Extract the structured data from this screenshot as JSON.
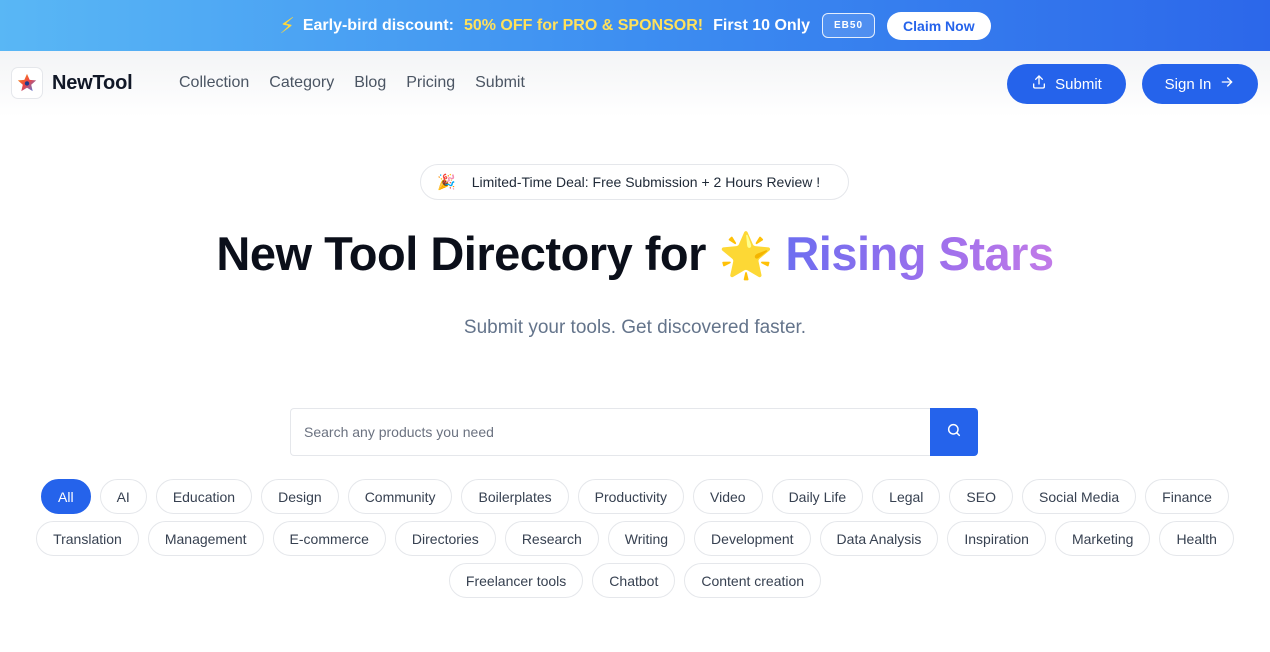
{
  "promo": {
    "prefix": "Early-bird discount:",
    "highlight": "50% OFF for PRO & SPONSOR!",
    "suffix": "First 10 Only",
    "code": "EB50",
    "claim_label": "Claim Now"
  },
  "nav": {
    "brand": "NewTool",
    "links": [
      "Collection",
      "Category",
      "Blog",
      "Pricing",
      "Submit"
    ],
    "submit_label": "Submit",
    "signin_label": "Sign In"
  },
  "hero": {
    "deal_text": "Limited-Time Deal: Free Submission + 2 Hours Review !",
    "title_main": "New Tool Directory for",
    "title_emoji": "🌟",
    "title_highlight": "Rising Stars",
    "subtitle": "Submit your tools. Get discovered faster."
  },
  "search": {
    "placeholder": "Search any products you need",
    "value": ""
  },
  "categories": {
    "selected": "All",
    "row1": [
      "All",
      "AI",
      "Education",
      "Design",
      "Community",
      "Boilerplates",
      "Productivity",
      "Video",
      "Daily Life",
      "Legal",
      "SEO",
      "Social Media",
      "Finance"
    ],
    "row2": [
      "Translation",
      "Management",
      "E-commerce",
      "Directories",
      "Research",
      "Writing",
      "Development",
      "Data Analysis",
      "Inspiration",
      "Marketing",
      "Health"
    ],
    "row3": [
      "Freelancer tools",
      "Chatbot",
      "Content creation"
    ]
  },
  "colors": {
    "accent": "#2563eb",
    "promo_highlight": "#ffe15c",
    "gradient_start": "#6d6ef0",
    "gradient_end": "#c27be8"
  }
}
